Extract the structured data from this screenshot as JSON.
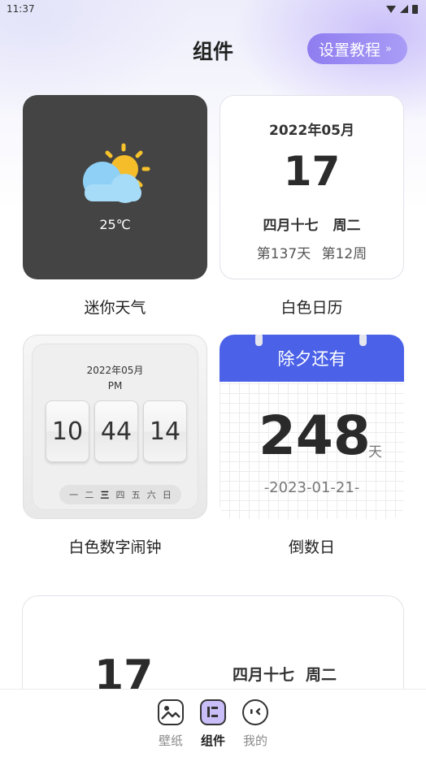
{
  "status_bar": {
    "time": "11:37"
  },
  "header": {
    "title": "组件",
    "tutorial_button": "设置教程",
    "tutorial_chevron": "»"
  },
  "widgets": {
    "weather": {
      "temperature": "25℃",
      "caption": "迷你天气"
    },
    "calendar": {
      "month": "2022年05月",
      "day": "17",
      "lunar": "四月十七",
      "weekday": "周二",
      "day_of_year": "第137天",
      "week_of_year": "第12周",
      "caption": "白色日历"
    },
    "clock": {
      "month": "2022年05月",
      "ampm": "PM",
      "hour": "10",
      "minute": "44",
      "second": "14",
      "weekdays": [
        "一",
        "二",
        "三",
        "四",
        "五",
        "六",
        "日"
      ],
      "active_weekday": "三",
      "caption": "白色数字闹钟"
    },
    "countdown": {
      "event": "除夕还有",
      "days": "248",
      "unit": "天",
      "date": "-2023-01-21-",
      "caption": "倒数日",
      "accent_color": "#4b62e8"
    },
    "preview": {
      "day": "17",
      "lunar": "四月十七",
      "weekday": "周二"
    }
  },
  "tab_bar": {
    "items": [
      {
        "label": "壁纸",
        "icon": "image-icon",
        "active": false
      },
      {
        "label": "组件",
        "icon": "widget-icon",
        "active": true
      },
      {
        "label": "我的",
        "icon": "face-icon",
        "active": false
      }
    ]
  },
  "colors": {
    "accent": "#8f7df0",
    "weather_bg": "#444444"
  }
}
